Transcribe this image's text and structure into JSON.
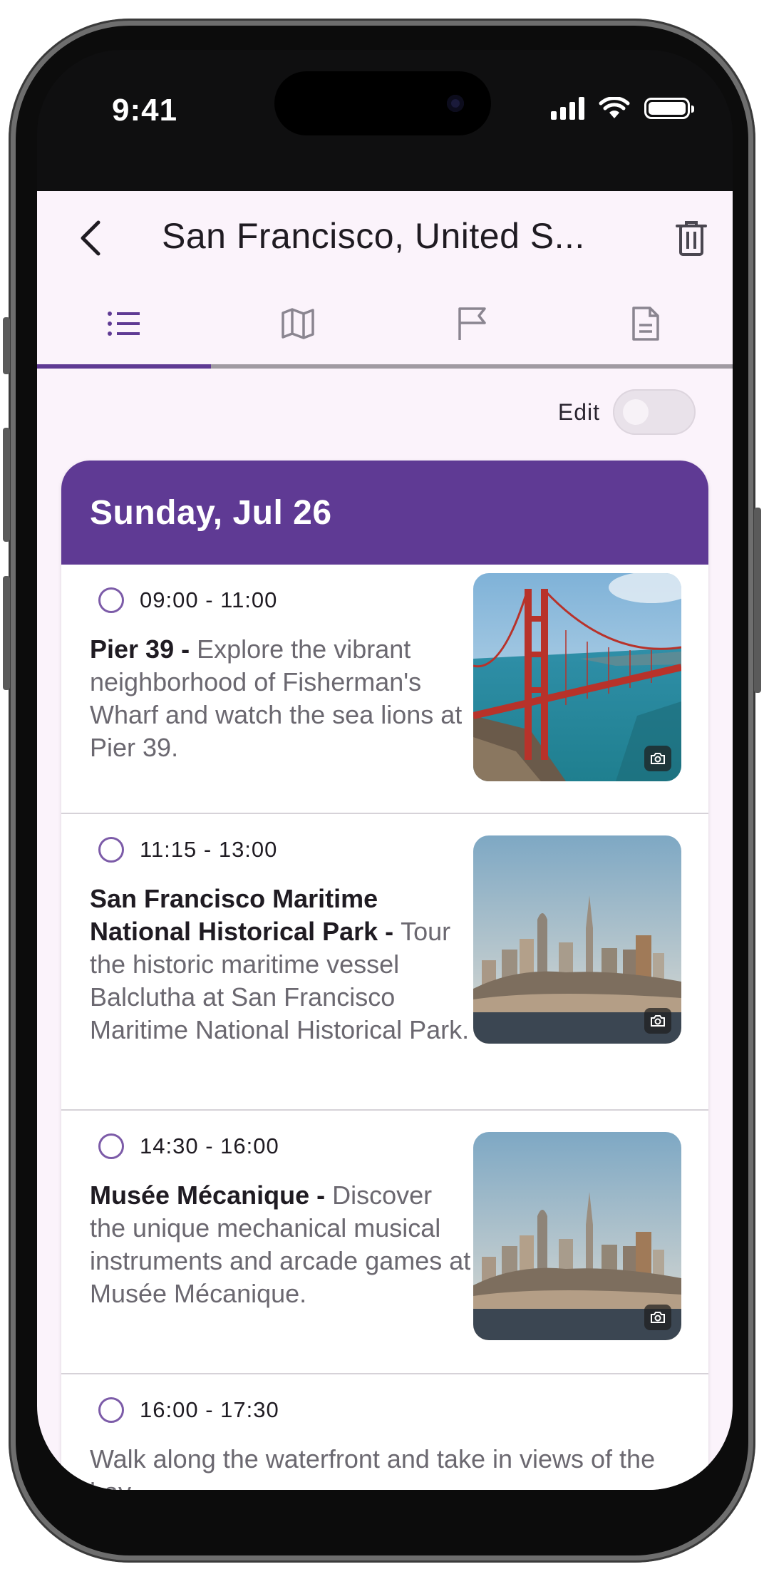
{
  "status_bar": {
    "time": "9:41"
  },
  "header": {
    "title": "San Francisco, United S...",
    "back_icon": "chevron-left-icon",
    "delete_icon": "trash-icon"
  },
  "tabs": [
    {
      "icon": "list-icon",
      "selected": true
    },
    {
      "icon": "map-icon",
      "selected": false
    },
    {
      "icon": "flag-icon",
      "selected": false
    },
    {
      "icon": "document-icon",
      "selected": false
    }
  ],
  "edit_toggle": {
    "label": "Edit",
    "on": false
  },
  "day": {
    "title": "Sunday, Jul 26",
    "activities": [
      {
        "time": "09:00 - 11:00",
        "place": "Pier 39 - ",
        "description": "Explore the vibrant neighborhood of Fisherman's Wharf and watch the sea lions at Pier 39.",
        "image": "golden-gate-bridge-photo"
      },
      {
        "time": "11:15 - 13:00",
        "place": "San Francisco Maritime National Historical Park - ",
        "description": "Tour the historic maritime vessel Balclutha at San Francisco Maritime National Historical Park.",
        "image": "sf-skyline-photo"
      },
      {
        "time": "14:30 - 16:00",
        "place": "Musée Mécanique - ",
        "description": "Discover the unique mechanical musical instruments and arcade games at Musée Mécanique.",
        "image": "sf-skyline-photo"
      },
      {
        "time": "16:00 - 17:30",
        "place": "",
        "description": "Walk along the waterfront and take in views of the bay"
      }
    ]
  },
  "colors": {
    "primary": "#5f3a94",
    "background": "#fbf3fb",
    "radio": "#7c5ba8"
  }
}
